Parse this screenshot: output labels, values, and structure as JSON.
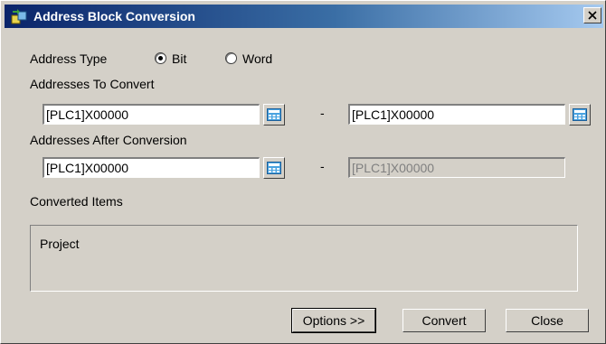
{
  "window": {
    "title": "Address Block Conversion",
    "close_glyph": "×"
  },
  "address_type": {
    "label": "Address Type",
    "options": [
      {
        "label": "Bit",
        "selected": true
      },
      {
        "label": "Word",
        "selected": false
      }
    ]
  },
  "convert_from": {
    "label": "Addresses To Convert",
    "start": "[PLC1]X00000",
    "end": "[PLC1]X00000",
    "separator": "-"
  },
  "convert_to": {
    "label": "Addresses After Conversion",
    "start": "[PLC1]X00000",
    "end": "[PLC1]X00000",
    "separator": "-"
  },
  "converted_items": {
    "label": "Converted Items",
    "items": [
      "Project"
    ]
  },
  "buttons": {
    "options": "Options >>",
    "convert": "Convert",
    "close": "Close"
  },
  "icons": {
    "title": "address-conversion-icon",
    "picker": "keypad-icon"
  }
}
